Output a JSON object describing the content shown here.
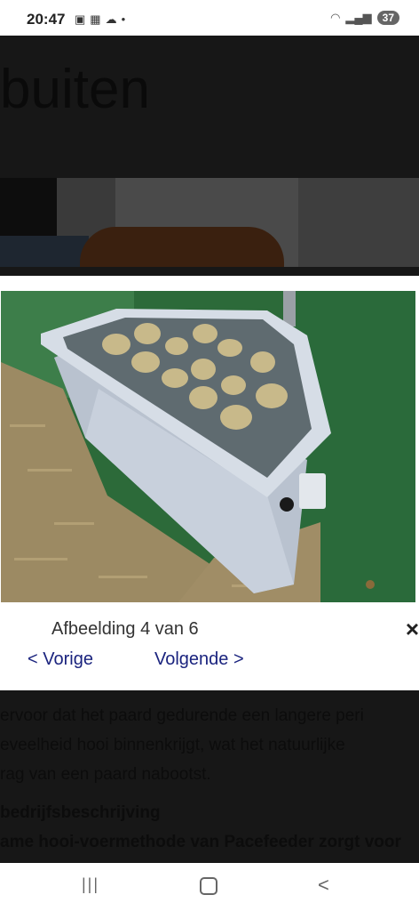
{
  "status_bar": {
    "time": "20:47",
    "left_icons": [
      "screenshot-icon",
      "calendar-icon",
      "cloud-icon",
      "dot-icon"
    ],
    "right_icons": [
      "wifi-icon",
      "signal-icon"
    ],
    "battery": "37"
  },
  "background": {
    "heading_fragment": "buiten",
    "paragraph_lines": [
      "ervoor dat het paard gedurende een langere peri",
      "eveelheid hooi binnenkrijgt, wat het natuurlijke",
      "rag van een paard nabootst."
    ],
    "section_heading": "bedrijfsbeschrijving",
    "bold_line": "ame hooi-voermethode van Pacefeeder zorgt voor"
  },
  "lightbox": {
    "caption": "Afbeelding 4 van 6",
    "prev_label": "< Vorige",
    "next_label": "Volgende >",
    "close_label": "×"
  },
  "nav_bar": {
    "recent_label": "|||",
    "back_label": "<"
  },
  "colors": {
    "link": "#1a237e",
    "stall_wall": "#2f6b3a",
    "feeder": "#c9d0dc"
  }
}
